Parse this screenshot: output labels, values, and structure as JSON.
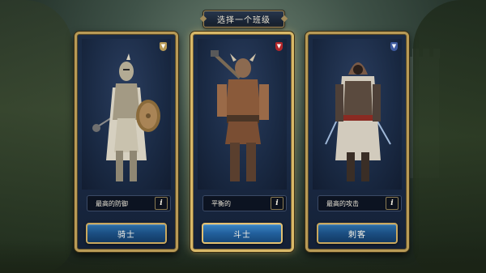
{
  "header": {
    "title": "选择一个班级"
  },
  "classes": [
    {
      "name": "骑士",
      "description": "最高的防御",
      "info_label": "i",
      "badge_color": "#b89a56",
      "figure_icon": "knight-figure-icon"
    },
    {
      "name": "斗士",
      "description": "平衡的",
      "info_label": "i",
      "badge_color": "#b2262a",
      "figure_icon": "brawler-figure-icon"
    },
    {
      "name": "刺客",
      "description": "最高的攻击",
      "info_label": "i",
      "badge_color": "#3e5a9e",
      "figure_icon": "assassin-figure-icon"
    }
  ],
  "colors": {
    "card_border": "#b89a56",
    "button_blue": "#1b4e82",
    "panel_navy": "#1a2a44"
  }
}
